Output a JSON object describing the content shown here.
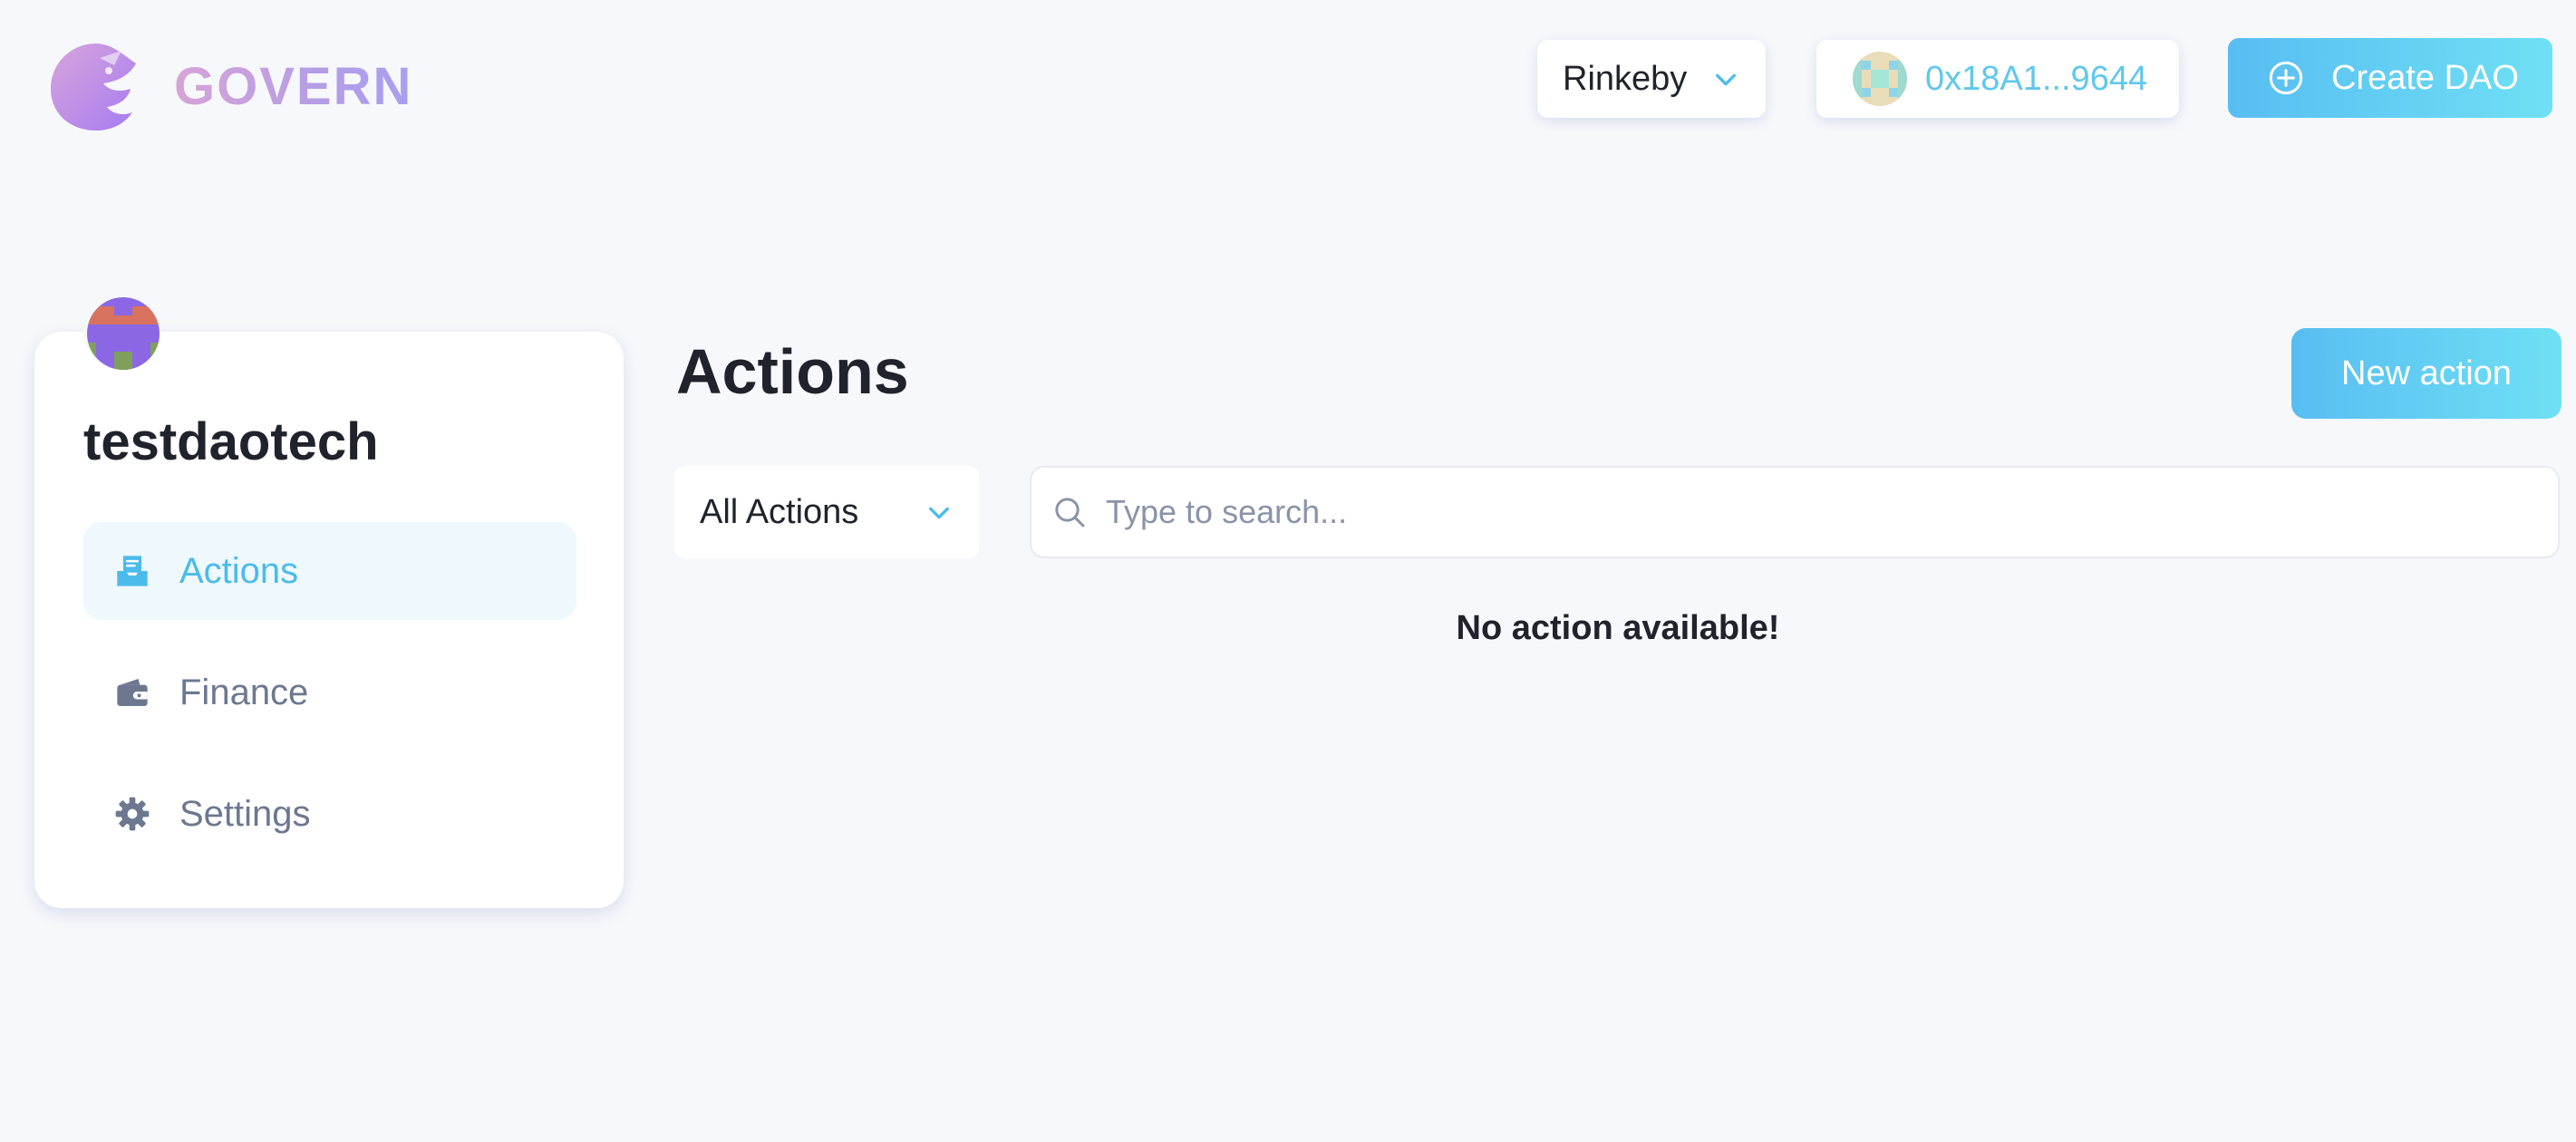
{
  "brand": {
    "name": "GOVERN"
  },
  "header": {
    "network": {
      "label": "Rinkeby"
    },
    "account": {
      "address": "0x18A1...9644"
    },
    "create_dao": {
      "label": "Create DAO"
    }
  },
  "sidebar": {
    "dao_name": "testdaotech",
    "items": [
      {
        "label": "Actions",
        "icon": "inbox-icon",
        "active": true
      },
      {
        "label": "Finance",
        "icon": "wallet-icon",
        "active": false
      },
      {
        "label": "Settings",
        "icon": "gear-icon",
        "active": false
      }
    ]
  },
  "main": {
    "title": "Actions",
    "new_action_label": "New action",
    "filter": {
      "selected": "All Actions"
    },
    "search": {
      "placeholder": "Type to search..."
    },
    "empty_message": "No action available!"
  },
  "colors": {
    "accent": "#4bbbeb",
    "button_gradient_start": "#58bdf2",
    "button_gradient_end": "#6fe0f4",
    "text_dark": "#20232b",
    "text_muted": "#6d7890",
    "background": "#f7f8fb"
  }
}
